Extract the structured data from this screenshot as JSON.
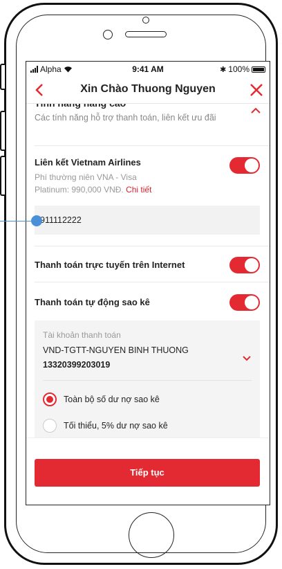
{
  "status": {
    "carrier": "Alpha",
    "time": "9:41 AM",
    "battery": "100%"
  },
  "nav": {
    "title": "Xin Chào Thuong Nguyen",
    "back_icon": "chevron-left-icon",
    "close_icon": "close-icon"
  },
  "features": {
    "title": "Tính năng nâng cao",
    "subtitle": "Các tính năng hỗ trợ thanh toán, liên kết ưu đãi"
  },
  "airlines": {
    "label": "Liên kết Vietnam Airlines",
    "desc_line1": "Phí thường niên VNA - Visa",
    "desc_line2": "Platinum: 990,000 VNĐ.",
    "link": "Chi tiết",
    "enabled": true,
    "member_value": "911112222"
  },
  "online_payment": {
    "label": "Thanh toán trực tuyến trên Internet",
    "enabled": true
  },
  "auto_payment": {
    "label": "Thanh toán tự động sao kê",
    "enabled": true,
    "account_label": "Tài khoản thanh toán",
    "account_name": "VND-TGTT-NGUYEN BINH THUONG",
    "account_number": "13320399203019",
    "options": [
      {
        "label": "Toàn bộ số dư nợ sao kê",
        "selected": true
      },
      {
        "label": "Tối thiểu, 5% dư nợ sao kê",
        "selected": false
      }
    ]
  },
  "continue_button": "Tiếp tục",
  "colors": {
    "accent": "#e32a32",
    "annotation": "#4a90d9"
  }
}
